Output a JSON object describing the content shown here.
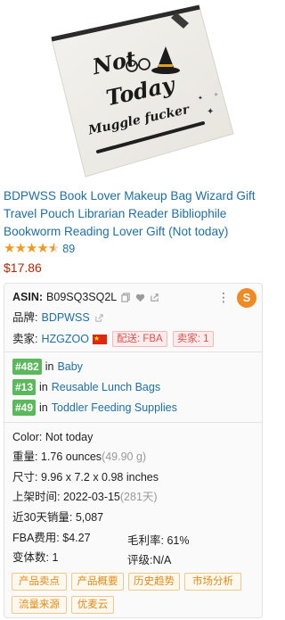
{
  "product": {
    "image_text": {
      "line1": "Not",
      "line2": "Today",
      "line3": "Muggle fucker"
    },
    "title": "BDPWSS Book Lover Makeup Bag Wizard Gift Travel Pouch Librarian Reader Bibliophile Bookworm Reading Lover Gift (Not today)",
    "rating_value": 4.5,
    "review_count": "89",
    "price": "$17.86"
  },
  "panel": {
    "asin_label": "ASIN:",
    "asin_value": "B09SQ3SQ2L",
    "brand_label": "品牌:",
    "brand_value": "BDPWSS",
    "seller_label": "卖家:",
    "seller_value": "HZGZOO",
    "tag_fba": "配送: FBA",
    "tag_seller_count": "卖家: 1",
    "ranks": [
      {
        "rank": "#482",
        "in": "in",
        "category": "Baby"
      },
      {
        "rank": "#13",
        "in": "in",
        "category": "Reusable Lunch Bags"
      },
      {
        "rank": "#49",
        "in": "in",
        "category": "Toddler Feeding Supplies"
      }
    ],
    "color": "Color: Not today",
    "weight_label": "重量: 1.76 ounces",
    "weight_grams": "(49.90 g)",
    "dims": "尺寸: 9.96 x 7.2 x 0.98 inches",
    "date_label": "上架时间: 2022-03-15",
    "date_days": "(281天)",
    "sales": "近30天销量: 5,087",
    "fba_fee": "FBA费用: $4.27",
    "margin": "毛利率: 61%",
    "variants": "变体数: 1",
    "review_rating": "评级:N/A",
    "buttons": [
      "产品卖点",
      "产品概要",
      "历史趋势",
      "市场分析",
      "流量来源",
      "优麦云"
    ],
    "logo_letter": "S"
  },
  "colors": {
    "link": "#1f6fa3",
    "price": "#b12704",
    "star": "#f29a1f",
    "rank_badge": "#5cb85c",
    "button_text": "#e38a17"
  }
}
